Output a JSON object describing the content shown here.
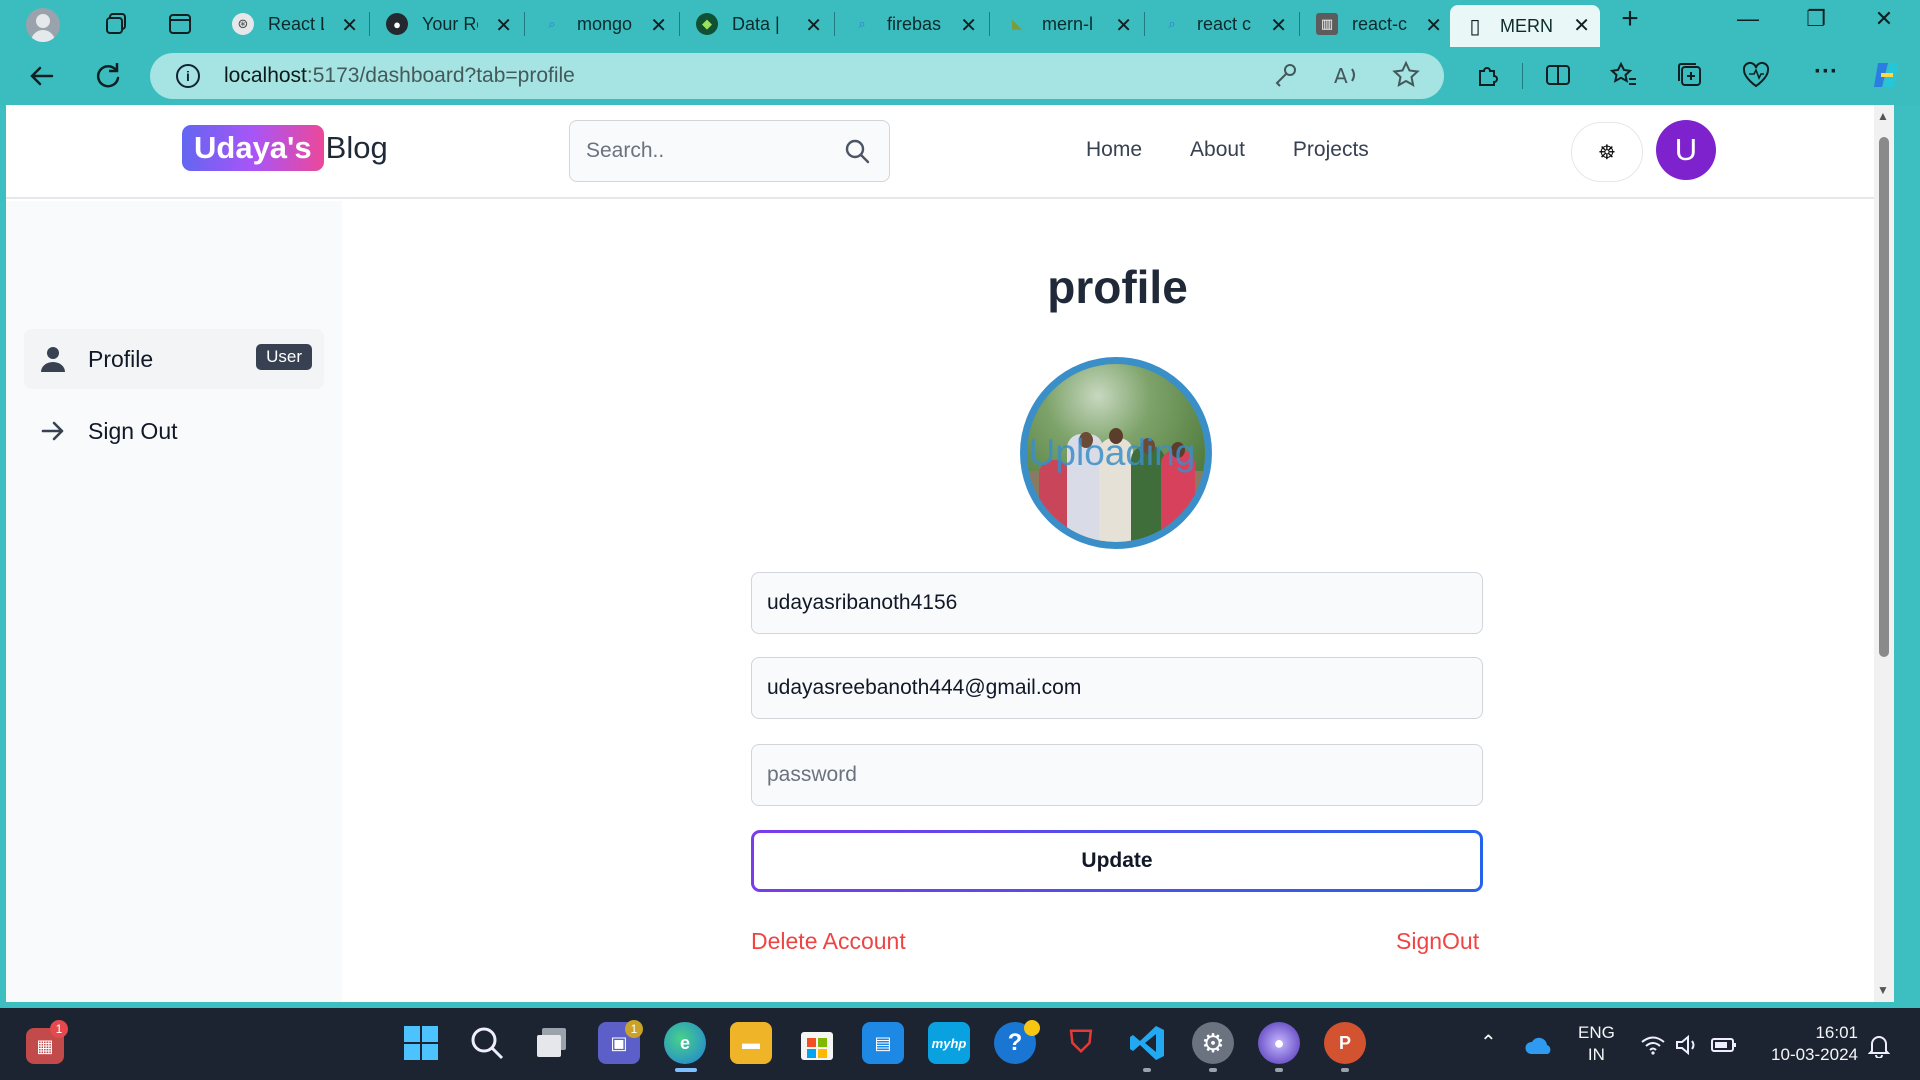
{
  "browser": {
    "tabs": [
      {
        "title": "React L",
        "fav_color": "#4a4a4a",
        "fav_glyph": "⊛"
      },
      {
        "title": "Your Re",
        "fav_color": "#24292f",
        "fav_glyph": "●"
      },
      {
        "title": "mongo",
        "fav_color": "#2d7fd3",
        "fav_glyph": "⌕"
      },
      {
        "title": "Data |",
        "fav_color": "#0f5132",
        "fav_glyph": "◆"
      },
      {
        "title": "firebas",
        "fav_color": "#2d7fd3",
        "fav_glyph": "⌕"
      },
      {
        "title": "mern-l",
        "fav_color": "#7a9d3a",
        "fav_glyph": "◣"
      },
      {
        "title": "react c",
        "fav_color": "#2d7fd3",
        "fav_glyph": "⌕"
      },
      {
        "title": "react-c",
        "fav_color": "#5c5c5c",
        "fav_glyph": "▥"
      },
      {
        "title": "MERN",
        "fav_color": "#ffffff",
        "fav_glyph": "▯"
      }
    ],
    "url_host": "localhost",
    "url_rest": ":5173/dashboard?tab=profile"
  },
  "site": {
    "logo_highlight": "Udaya's",
    "logo_rest": "Blog",
    "search_placeholder": "Search..",
    "nav": {
      "home": "Home",
      "about": "About",
      "projects": "Projects"
    },
    "theme_icon": "☸",
    "avatar_letter": "U"
  },
  "sidebar": {
    "profile_label": "Profile",
    "profile_badge": "User",
    "signout_label": "Sign Out"
  },
  "profile": {
    "heading": "profile",
    "photo_overlay": "Uploading",
    "username": "udayasribanoth4156",
    "email": "udayasreebanoth444@gmail.com",
    "password_placeholder": "password",
    "update_label": "Update",
    "delete_label": "Delete Account",
    "signout_label": "SignOut"
  },
  "taskbar": {
    "lang_top": "ENG",
    "lang_bottom": "IN",
    "time": "16:01",
    "date": "10-03-2024",
    "widgets_badge": "1",
    "teams_badge": "1"
  },
  "colors": {
    "browser_chrome": "#3bbdbf",
    "logo_gradient_start": "#6366f1",
    "logo_gradient_end": "#ec4899",
    "avatar": "#7e22ce",
    "danger": "#ef4444",
    "photo_ring": "#3a8fc8"
  }
}
